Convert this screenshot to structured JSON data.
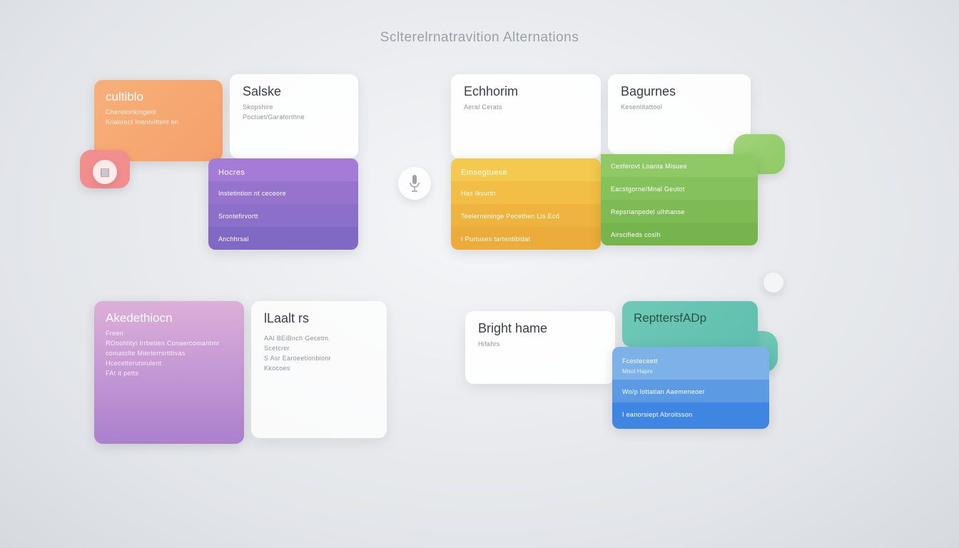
{
  "title": "Sclterelrnatravition Alternations",
  "groups": {
    "g1": {
      "colorCard": {
        "label": "cultiblo",
        "sub": "Cheretorikingent",
        "line": "Knaorect Inentvittent en"
      },
      "whiteCard": {
        "label": "Salske",
        "sub": "Skopshire",
        "line": "Poctuet/Garaforthne"
      },
      "stack": {
        "hdr": "Hocres",
        "rows": [
          {
            "label": "Instetintion nt ceceore"
          },
          {
            "label": "Srontefirvortt"
          },
          {
            "label": "Anchhrsal"
          }
        ]
      }
    },
    "g2": {
      "whiteCard": {
        "label": "Echhorim",
        "sub": "Aeral Cerats"
      },
      "sideCard": {
        "label": "Bagurnes",
        "sub": "Kesenlitattool"
      },
      "stack": {
        "hdr": "Emsegtuese",
        "rows": [
          {
            "label": "Has Iksurtn"
          },
          {
            "label": "Teelerneninge Pecethen Lls Ecd"
          },
          {
            "label": "I Purtuses tartentibldat"
          }
        ]
      },
      "rightStack": {
        "rows": [
          {
            "label": "Cesferovt Loanta Misuee"
          },
          {
            "label": "Eacstgorne/Mnal Geutot"
          },
          {
            "label": "Repsrianpedel ulhhanse"
          },
          {
            "label": "Airscifieds coslh"
          }
        ]
      }
    },
    "g3": {
      "colorCard": {
        "label": "Akedethiocn",
        "sub": "Freen",
        "lines": [
          "ROoohlityi Irrbetien Conaercomantmr",
          "comatolte Mierterrsrtttivas",
          "Hcecetterutsrulent",
          "FAt it petts"
        ]
      },
      "whiteCard": {
        "label": "lLaalt rs",
        "lines": [
          "AAl BEiBnch Gecetm",
          "Scetcrer",
          "S Asr Earoeetionbionr",
          "Kkocoes"
        ]
      }
    },
    "g4": {
      "whiteCard": {
        "label": "Bright hame",
        "sub": "Hifahrs"
      },
      "sideCard": {
        "label": "RepttersfADp"
      },
      "stack": {
        "rows": [
          {
            "label": "Fcesteceett",
            "sub": "Misol Hapre"
          },
          {
            "label": "Wo/p lottatian Aaemeneoer"
          },
          {
            "label": "I eanorsiept Abroitsson"
          }
        ]
      }
    }
  },
  "colors": {
    "orange": "#f6a06a",
    "orangeDeep": "#ef8a5e",
    "salmon": "#f28e8e",
    "purple1": "#a47bd6",
    "purple2": "#8b72cc",
    "purple3": "#7d6bc4",
    "yellow": "#f5c94e",
    "amber": "#f0b53f",
    "teal": "#5fbfae",
    "tealPill": "#6fc9b6",
    "green": "#8fc965",
    "greenDeep": "#7fbd55",
    "lilac1": "#d7a4d6",
    "lilac2": "#c795d4",
    "lilac3": "#b98ad1",
    "lilac4": "#ab80cd",
    "skyblue": "#6ea9e6",
    "blue": "#3e86e2",
    "microphone": "#9ca1ab"
  }
}
